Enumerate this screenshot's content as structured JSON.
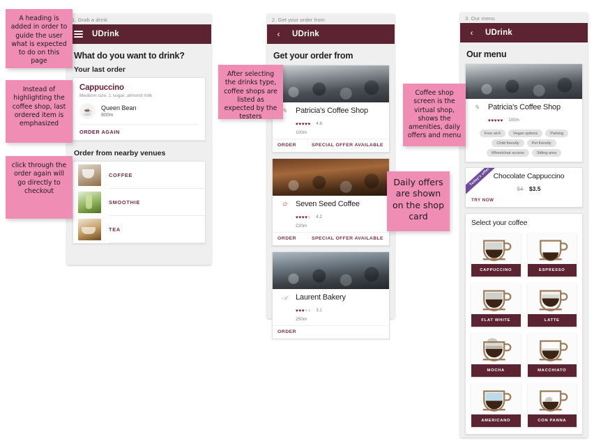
{
  "screens": [
    {
      "step_label": "1. Grab a drink",
      "appbar": {
        "title": "UDrink",
        "menu_icon": "hamburger-icon"
      },
      "heading": "What do you want to drink?",
      "section_title": "Your last order",
      "last_order": {
        "drink": "Cappuccino",
        "details": "Medium size, 1 sugar, almond milk",
        "shop": "Queen Bean",
        "distance": "800m",
        "action": "ORDER AGAIN"
      },
      "nearby_title": "Order from nearby venues",
      "venues": [
        {
          "label": "COFFEE",
          "thumb": "coffee-thumb"
        },
        {
          "label": "SMOOTHIE",
          "thumb": "smoothie-thumb"
        },
        {
          "label": "TEA",
          "thumb": "tea-thumb"
        }
      ]
    },
    {
      "step_label": "2. Get your order from",
      "appbar": {
        "title": "UDrink",
        "back_icon": "back-chevron-icon"
      },
      "heading": "Get your order from",
      "shops": [
        {
          "name": "Patricia's Coffee Shop",
          "rating": "4.8",
          "hearts_full": 5,
          "distance": "100m",
          "order_label": "ORDER",
          "offer_label": "SPECIAL OFFER AVAILABLE"
        },
        {
          "name": "Seven Seed Coffee",
          "rating": "4.2",
          "hearts_full": 4,
          "distance": "220m",
          "order_label": "ORDER",
          "offer_label": "SPECIAL OFFER AVAILABLE"
        },
        {
          "name": "Laurent Bakery",
          "rating": "3.1",
          "hearts_full": 3,
          "distance": "250m",
          "order_label": "ORDER",
          "offer_label": ""
        }
      ]
    },
    {
      "step_label": "3. Our menu",
      "appbar": {
        "title": "UDrink",
        "back_icon": "back-chevron-icon"
      },
      "heading": "Our menu",
      "shop": {
        "name": "Patricia's Coffee Shop",
        "rating_hearts": 5,
        "distance": "100m",
        "amenities": [
          "Free wi-fi",
          "Vegan options",
          "Parking",
          "Child friendly",
          "Pet friendly",
          "Wheelchair access",
          "Sitting area"
        ]
      },
      "offer": {
        "ribbon": "Today's offer",
        "title": "Chocolate Cappuccino",
        "price_old": "$4",
        "price_new": "$3.5",
        "action": "TRY NOW"
      },
      "select": {
        "title": "Select your coffee",
        "items": [
          {
            "label": "CAPPUCCINO",
            "icon": "cappuccino-cup-icon"
          },
          {
            "label": "ESPRESSO",
            "icon": "espresso-cup-icon"
          },
          {
            "label": "FLAT WHITE",
            "icon": "flat-white-cup-icon"
          },
          {
            "label": "LATTE",
            "icon": "latte-cup-icon"
          },
          {
            "label": "MOCHA",
            "icon": "mocha-cup-icon"
          },
          {
            "label": "MACCHIATO",
            "icon": "macchiato-cup-icon"
          },
          {
            "label": "AMERICANO",
            "icon": "americano-cup-icon"
          },
          {
            "label": "CON PANNA",
            "icon": "con-panna-cup-icon"
          }
        ]
      }
    }
  ],
  "notes": [
    {
      "text": "A heading is added in order to guide the user what is expected to do on this page"
    },
    {
      "text": "Instead of highlighting the coffee shop, last ordered item is emphasized"
    },
    {
      "text": "click through the order again will go directly to checkout"
    },
    {
      "text": "After selecting the drinks type, coffee shops are listed as expected by the testers"
    },
    {
      "text": "Coffee shop screen is the virtual shop, shows the amenities, daily offers and menu"
    },
    {
      "text": "Daily offers are shown on the shop card"
    }
  ],
  "colors": {
    "appbar": "#5c2333",
    "accent": "#7a2d44",
    "note": "#ef8db4",
    "ribbon": "#6f4b9c"
  }
}
